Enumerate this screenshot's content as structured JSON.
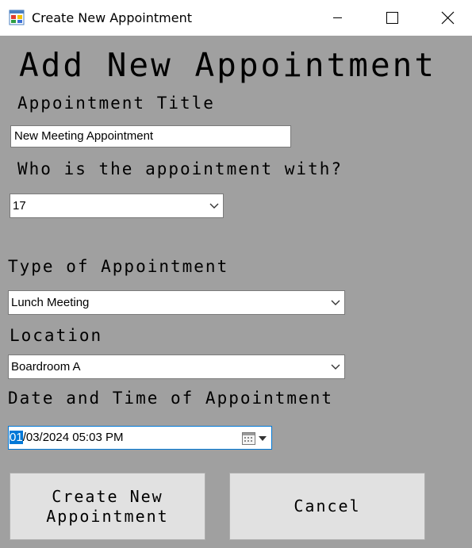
{
  "window": {
    "title": "Create New Appointment"
  },
  "form": {
    "heading": "Add New Appointment",
    "title_label": "Appointment Title",
    "title_value": "New Meeting Appointment",
    "with_label": "Who is the appointment with?",
    "with_value": "17",
    "type_label": "Type of Appointment",
    "type_value": "Lunch Meeting",
    "location_label": "Location",
    "location_value": "Boardroom A",
    "datetime_label": "Date and Time of Appointment",
    "datetime_selected": "01",
    "datetime_rest": "/03/2024 05:03 PM"
  },
  "buttons": {
    "create_label": "Create New Appointment",
    "cancel_label": "Cancel"
  },
  "icons": {
    "app": "app-form-icon",
    "minimize": "minimize-icon",
    "maximize": "maximize-icon",
    "close": "close-icon",
    "dropdown": "chevron-down-icon",
    "calendar": "calendar-icon"
  }
}
